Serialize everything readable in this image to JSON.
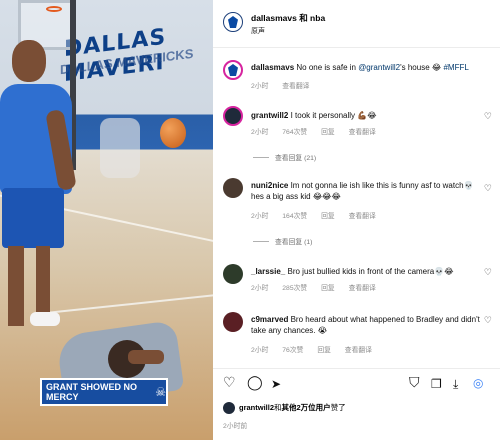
{
  "video": {
    "wall_text": "DALLAS MAVERI",
    "wall_sub_text": "DALLAS MAVERICKS",
    "caption": "GRANT SHOWED NO MERCY",
    "caption_emoji": "☠"
  },
  "header": {
    "title": "dallasmavs 和 nba",
    "subtitle": "原声",
    "more": "···"
  },
  "post": {
    "author": "dallasmavs",
    "text_before": "No one is safe in ",
    "mention": "@grantwill2",
    "text_after": "'s house ",
    "emoji": "😂",
    "hashtag": "#MFFL",
    "time": "2小时",
    "see_translation": "查看翻译"
  },
  "comments": [
    {
      "user": "grantwill2",
      "text": "I took it personally ",
      "emoji": "💪🏾😂",
      "time": "2小时",
      "likes": "764次赞",
      "reply": "回复",
      "translate": "查看翻译",
      "view_replies": "查看回复 (21)"
    },
    {
      "user": "nuni2nice",
      "text": "Im not gonna lie ish like this is funny asf to watch",
      "emoji": "💀",
      "text2": " hes a big ass kid ",
      "emoji2": "😂😂😂",
      "time": "2小时",
      "likes": "164次赞",
      "reply": "回复",
      "translate": "查看翻译",
      "view_replies": "查看回复 (1)"
    },
    {
      "user": "_larssie_",
      "text": "Bro just bullied kids in front of the camera",
      "emoji": "💀😂",
      "time": "2小时",
      "likes": "285次赞",
      "reply": "回复",
      "translate": "查看翻译"
    },
    {
      "user": "c9marved",
      "text": "Bro heard about what happened to Bradley and didn't take any chances. ",
      "emoji": "😭",
      "time": "2小时",
      "likes": "76次赞",
      "reply": "回复",
      "translate": "查看翻译"
    }
  ],
  "actions": {
    "like_icon": "♡",
    "comment_icon": "◯",
    "share_icon": "➤",
    "save_icon": "⛉"
  },
  "footer": {
    "liker": "grantwill2",
    "likes_suffix_before": "和",
    "others": "其他2万位用户",
    "likes_suffix_after": "赞了",
    "time": "2小时前"
  }
}
